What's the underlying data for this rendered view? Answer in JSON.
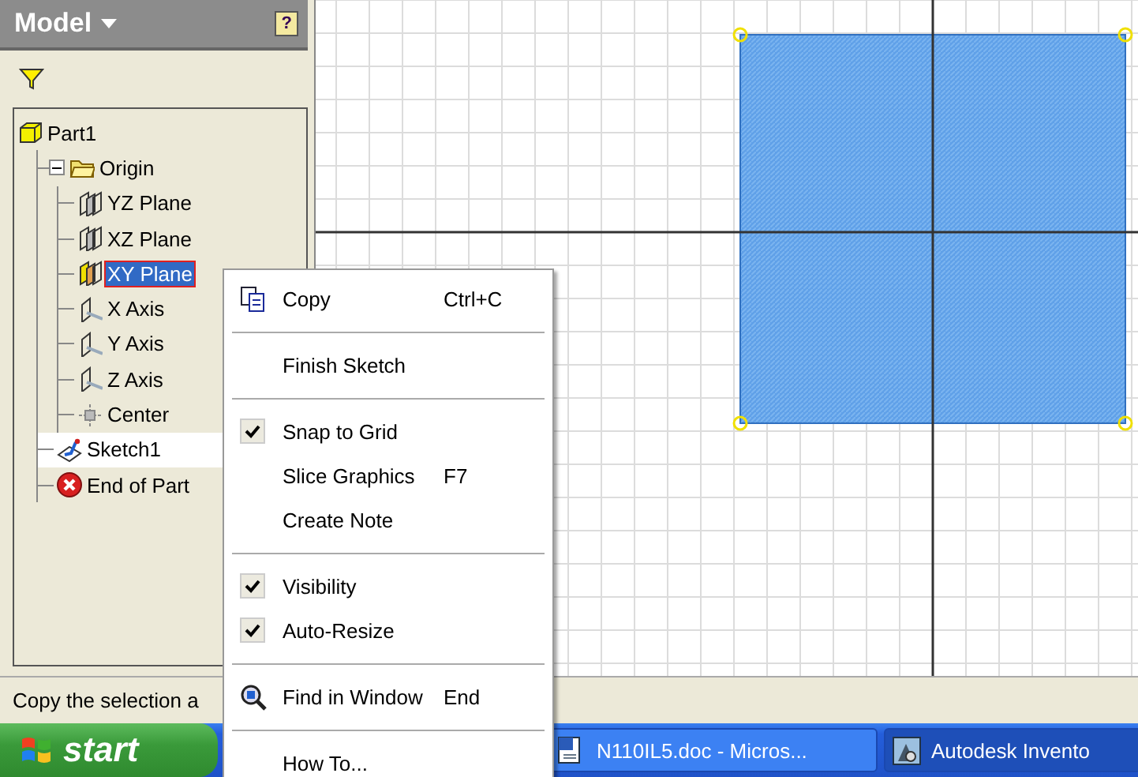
{
  "browser": {
    "title": "Model",
    "help": "?"
  },
  "tree": [
    {
      "label": "Part1",
      "kind": "part",
      "selected": false,
      "active": false,
      "children": [
        {
          "label": "Origin",
          "kind": "folder",
          "selected": false,
          "active": false,
          "expanded": true,
          "children": [
            {
              "label": "YZ Plane",
              "kind": "plane",
              "selected": false,
              "active": false
            },
            {
              "label": "XZ Plane",
              "kind": "plane",
              "selected": false,
              "active": false
            },
            {
              "label": "XY Plane",
              "kind": "plane",
              "selected": true,
              "active": false
            },
            {
              "label": "X Axis",
              "kind": "axis",
              "selected": false,
              "active": false
            },
            {
              "label": "Y Axis",
              "kind": "axis",
              "selected": false,
              "active": false
            },
            {
              "label": "Z Axis",
              "kind": "axis",
              "selected": false,
              "active": false
            },
            {
              "label": "Center",
              "kind": "point",
              "selected": false,
              "active": false
            }
          ]
        },
        {
          "label": "Sketch1",
          "kind": "sketch",
          "selected": false,
          "active": true
        },
        {
          "label": "End of Part",
          "kind": "end",
          "selected": false,
          "active": false
        }
      ]
    }
  ],
  "context_menu": [
    {
      "kind": "copy",
      "label": "Copy",
      "shortcut": "Ctrl+C",
      "checked": false
    },
    {
      "kind": "separator"
    },
    {
      "kind": "item",
      "label": "Finish Sketch",
      "checked": false
    },
    {
      "kind": "separator"
    },
    {
      "kind": "item",
      "label": "Snap to Grid",
      "checked": true
    },
    {
      "kind": "item",
      "label": "Slice Graphics",
      "shortcut": "F7",
      "checked": false
    },
    {
      "kind": "item",
      "label": "Create Note",
      "checked": false
    },
    {
      "kind": "separator"
    },
    {
      "kind": "item",
      "label": "Visibility",
      "checked": true
    },
    {
      "kind": "item",
      "label": "Auto-Resize",
      "checked": true
    },
    {
      "kind": "separator"
    },
    {
      "kind": "find",
      "label": "Find in Window",
      "shortcut": "End",
      "checked": false
    },
    {
      "kind": "separator"
    },
    {
      "kind": "item",
      "label": "How To...",
      "checked": false
    }
  ],
  "status_bar": {
    "text": "Copy the selection a"
  },
  "taskbar": {
    "start": "start",
    "tasks": [
      {
        "label": "N110IL5.doc - Micros...",
        "kind": "word",
        "selected": false
      },
      {
        "label": "Autodesk Invento",
        "kind": "inventor",
        "selected": true
      }
    ]
  }
}
